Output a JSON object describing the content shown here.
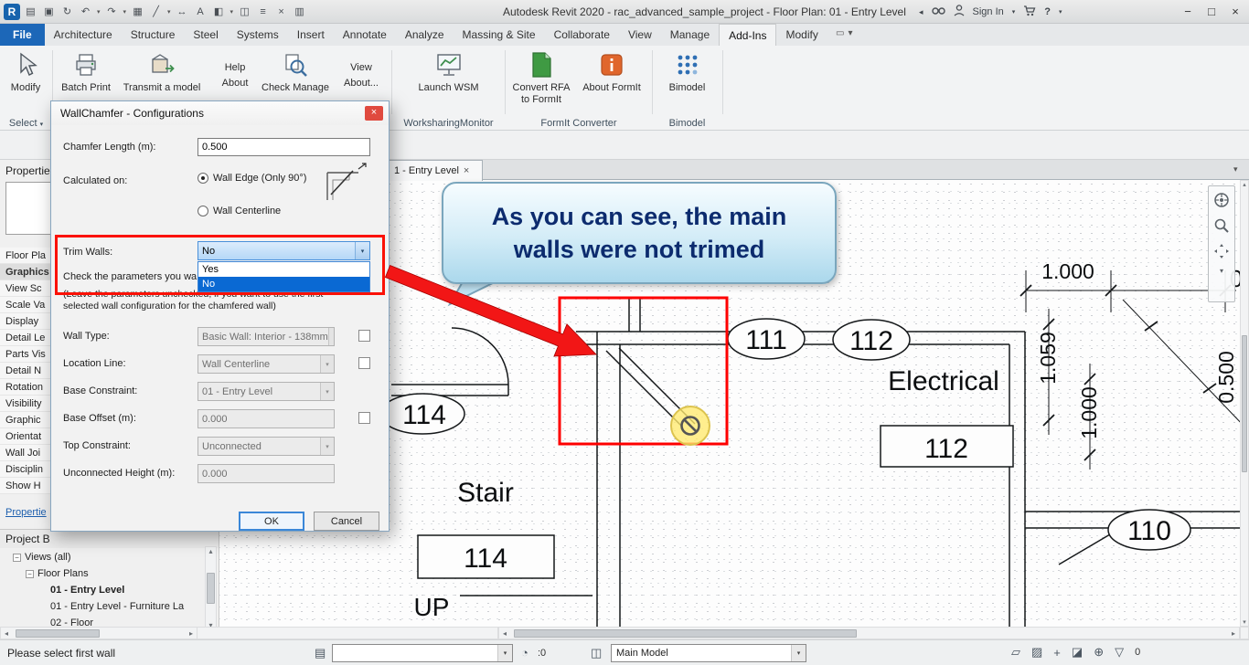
{
  "titlebar": {
    "title": "Autodesk Revit 2020 - rac_advanced_sample_project - Floor Plan: 01 - Entry Level",
    "sign_in": "Sign In",
    "icons": [
      "revit-icon",
      "open-icon",
      "save-icon",
      "sync-icon",
      "undo-icon",
      "redo-icon",
      "print-icon",
      "measure-icon",
      "dimension-icon",
      "text-icon",
      "3d-view-icon",
      "section-icon",
      "thin-lines-icon",
      "close-hidden-icon",
      "switch-windows-icon"
    ]
  },
  "ribbon": {
    "tabs": [
      "File",
      "Architecture",
      "Structure",
      "Steel",
      "Systems",
      "Insert",
      "Annotate",
      "Analyze",
      "Massing & Site",
      "Collaborate",
      "View",
      "Manage",
      "Add-Ins",
      "Modify"
    ],
    "active_tab": "Add-Ins",
    "modify_label": "Modify",
    "select_label": "Select",
    "batch_print": "Batch Print",
    "transmit": "Transmit a model",
    "help_line1": "Help",
    "help_line2": "About",
    "check_manage": "Check Manage",
    "view_line1": "View",
    "view_line2": "About...",
    "launch_wsm": "Launch WSM",
    "wsm_panel": "WorksharingMonitor",
    "convert_rfa_line1": "Convert RFA",
    "convert_rfa_line2": "to FormIt",
    "about_formit": "About FormIt",
    "formit_panel": "FormIt Converter",
    "bimodel": "Bimodel",
    "bimodel_panel": "Bimodel"
  },
  "properties": {
    "header": "Propertie",
    "rows": [
      "Floor Pla",
      "Graphics",
      "View Sc",
      "Scale Va",
      "Display",
      "Detail Le",
      "Parts Vis",
      "Detail N",
      "Rotation",
      "Visibility",
      "Graphic",
      "Orientat",
      "Wall Joi",
      "Disciplin",
      "Show H"
    ],
    "help_link": "Propertie"
  },
  "browser": {
    "header": "Project B",
    "items": [
      {
        "label": "Views (all)",
        "indent": 1,
        "bold": false,
        "expander": true
      },
      {
        "label": "Floor Plans",
        "indent": 2,
        "bold": false,
        "expander": true
      },
      {
        "label": "01 - Entry Level",
        "indent": 3,
        "bold": true,
        "expander": false
      },
      {
        "label": "01 - Entry Level - Furniture La",
        "indent": 3,
        "bold": false,
        "expander": false
      },
      {
        "label": "02 - Floor",
        "indent": 3,
        "bold": false,
        "expander": false
      }
    ]
  },
  "dialog": {
    "title": "WallChamfer - Configurations",
    "chamfer_length_label": "Chamfer Length (m):",
    "chamfer_length_value": "0.500",
    "calculated_on_label": "Calculated on:",
    "radio_wall_edge": "Wall Edge (Only 90°)",
    "radio_wall_centerline": "Wall Centerline",
    "trim_walls_label": "Trim Walls:",
    "trim_walls_value": "No",
    "dropdown_options": [
      "Yes",
      "No"
    ],
    "dropdown_selected": "No",
    "check_params_text": "Check the parameters you wa",
    "leave_note": "(Leave the parameters unchecked, if you want to use the first\nselected wall configuration for the chamfered wall)",
    "rows": [
      {
        "label": "Wall Type:",
        "value": "Basic Wall: Interior - 138mm",
        "combo": true,
        "checkbox": true
      },
      {
        "label": "Location Line:",
        "value": "Wall Centerline",
        "combo": true,
        "checkbox": true
      },
      {
        "label": "Base Constraint:",
        "value": "01 - Entry Level",
        "combo": true,
        "checkbox": false
      },
      {
        "label": "Base Offset (m):",
        "value": "0.000",
        "combo": false,
        "checkbox": true
      },
      {
        "label": "Top Constraint:",
        "value": "Unconnected",
        "combo": true,
        "checkbox": false
      },
      {
        "label": "Unconnected Height (m):",
        "value": "0.000",
        "combo": false,
        "checkbox": false
      }
    ],
    "ok": "OK",
    "cancel": "Cancel"
  },
  "canvas": {
    "view_tab": "1 - Entry Level",
    "callout": "As you can see, the main\nwalls were not trimed",
    "plan": {
      "room_111": "111",
      "room_112": "112",
      "room_110": "110",
      "room_114": "114",
      "box_112": "112",
      "box_114": "114",
      "electrical": "Electrical",
      "stair": "Stair",
      "up": "UP",
      "dim_1000_a": "1.000",
      "dim_1059": "1.059",
      "dim_1000_b": "1.000",
      "dim_0500": "0.500",
      "dim_0": "0"
    }
  },
  "statusbar": {
    "message": "Please select first wall",
    "active_workset_value": "",
    "editable_count": ":0",
    "design_option_value": "Main Model",
    "filter_count": "0",
    "right_icons": [
      "select-links-icon",
      "select-underlay-icon",
      "select-pinned-icon",
      "select-by-face-icon",
      "drag-on-selection-icon",
      "filter-icon"
    ]
  }
}
